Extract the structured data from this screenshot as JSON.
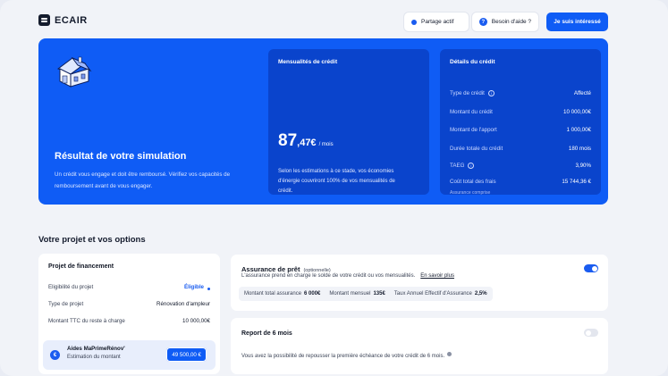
{
  "brand": {
    "name": "ECAIR"
  },
  "header": {
    "sharing_label": "Partage actif",
    "help_label": "Besoin d'aide ?",
    "cta_label": "Je suis intéressé"
  },
  "hero": {
    "title": "Résultat de votre simulation",
    "description": "Un crédit vous engage et doit être remboursé. Vérifiez vos capacités de remboursement avant de vous engager."
  },
  "monthly": {
    "title": "Mensualités de crédit",
    "amount_int": "87",
    "amount_dec": ",47€",
    "amount_unit": "/ mois",
    "description": "Selon les estimations à ce stade, vos économies d'énergie couvriront 100% de vos mensualités de crédit."
  },
  "details": {
    "title": "Détails du crédit",
    "rows": [
      {
        "label": "Type de crédit",
        "value": "Affecté",
        "info": true
      },
      {
        "label": "Montant du crédit",
        "value": "10 000,00€",
        "info": false
      },
      {
        "label": "Montant de l'apport",
        "value": "1 000,00€",
        "info": false
      },
      {
        "label": "Durée totale du crédit",
        "value": "180 mois",
        "info": false
      },
      {
        "label": "TAEG",
        "value": "3,90%",
        "info": true
      },
      {
        "label": "Coût total des frais",
        "value": "15 744,36 €",
        "info": false
      }
    ],
    "footnote": "Assurance comprise"
  },
  "section": {
    "title": "Votre projet et vos options"
  },
  "project": {
    "title": "Projet de financement",
    "rows": [
      {
        "label": "Eligibilité du projet",
        "value": "Éligible"
      },
      {
        "label": "Type de projet",
        "value": "Rénovation d'ampleur"
      },
      {
        "label": "Montant TTC du reste à charge",
        "value": "10 000,00€"
      }
    ],
    "aides": {
      "title": "Aides MaPrimeRénov'",
      "subtitle": "Estimation du montant",
      "amount": "49 500,00 €"
    }
  },
  "insurance": {
    "title": "Assurance de prêt",
    "optional": "(optionnelle)",
    "description": "L'assurance prend en charge le solde de votre crédit ou vos mensualités.",
    "link": "En savoir plus",
    "enabled": true,
    "stats": [
      {
        "label": "Montant total assurance",
        "value": "6 000€"
      },
      {
        "label": "Montant mensuel",
        "value": "135€"
      },
      {
        "label": "Taux Annuel Effectif d'Assurance",
        "value": "2,5%"
      }
    ]
  },
  "deferral": {
    "title": "Report de 6 mois",
    "description": "Vous avez la possibilité de repousser la première échéance de votre crédit de 6 mois.",
    "enabled": false
  },
  "colors": {
    "primary": "#0f5cf5",
    "panel": "#0a44cc",
    "background": "#f1f3f8"
  }
}
